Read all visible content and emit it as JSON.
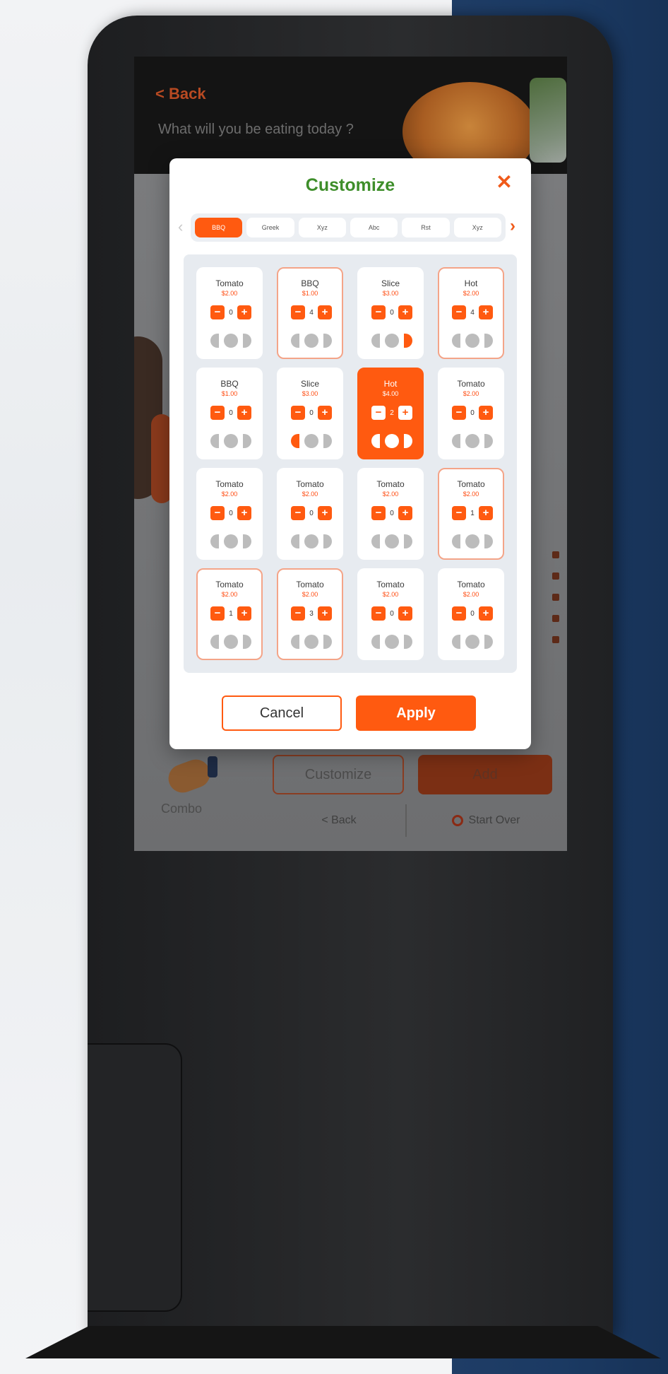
{
  "header": {
    "back_label": "< Back",
    "question": "What will you be eating today ?"
  },
  "modal": {
    "title": "Customize",
    "close_icon": "close-icon",
    "tabs": [
      {
        "label": "BBQ",
        "active": true
      },
      {
        "label": "Greek",
        "active": false
      },
      {
        "label": "Xyz",
        "active": false
      },
      {
        "label": "Abc",
        "active": false
      },
      {
        "label": "Rst",
        "active": false
      },
      {
        "label": "Xyz",
        "active": false
      }
    ],
    "items": [
      {
        "name": "Tomato",
        "price": "$2.00",
        "qty": "0",
        "state": "normal",
        "portion": "none"
      },
      {
        "name": "BBQ",
        "price": "$1.00",
        "qty": "4",
        "state": "outlined",
        "portion": "none"
      },
      {
        "name": "Slice",
        "price": "$3.00",
        "qty": "0",
        "state": "normal",
        "portion": "right"
      },
      {
        "name": "Hot",
        "price": "$2.00",
        "qty": "4",
        "state": "outlined",
        "portion": "none"
      },
      {
        "name": "BBQ",
        "price": "$1.00",
        "qty": "0",
        "state": "normal",
        "portion": "none"
      },
      {
        "name": "Slice",
        "price": "$3.00",
        "qty": "0",
        "state": "normal",
        "portion": "left"
      },
      {
        "name": "Hot",
        "price": "$4.00",
        "qty": "2",
        "state": "selected",
        "portion": "whole"
      },
      {
        "name": "Tomato",
        "price": "$2.00",
        "qty": "0",
        "state": "normal",
        "portion": "none"
      },
      {
        "name": "Tomato",
        "price": "$2.00",
        "qty": "0",
        "state": "normal",
        "portion": "none"
      },
      {
        "name": "Tomato",
        "price": "$2.00",
        "qty": "0",
        "state": "normal",
        "portion": "none"
      },
      {
        "name": "Tomato",
        "price": "$2.00",
        "qty": "0",
        "state": "normal",
        "portion": "none"
      },
      {
        "name": "Tomato",
        "price": "$2.00",
        "qty": "1",
        "state": "outlined",
        "portion": "none"
      },
      {
        "name": "Tomato",
        "price": "$2.00",
        "qty": "1",
        "state": "outlined",
        "portion": "none"
      },
      {
        "name": "Tomato",
        "price": "$2.00",
        "qty": "3",
        "state": "outlined",
        "portion": "none"
      },
      {
        "name": "Tomato",
        "price": "$2.00",
        "qty": "0",
        "state": "normal",
        "portion": "none"
      },
      {
        "name": "Tomato",
        "price": "$2.00",
        "qty": "0",
        "state": "normal",
        "portion": "none"
      }
    ],
    "cancel_label": "Cancel",
    "apply_label": "Apply"
  },
  "background_ui": {
    "combo_label": "Combo",
    "customize_label": "Customize",
    "add_label": "Add",
    "back_label": "< Back",
    "start_over_label": "Start Over"
  },
  "colors": {
    "accent": "#ff5a10",
    "title_green": "#3e8e2a"
  }
}
